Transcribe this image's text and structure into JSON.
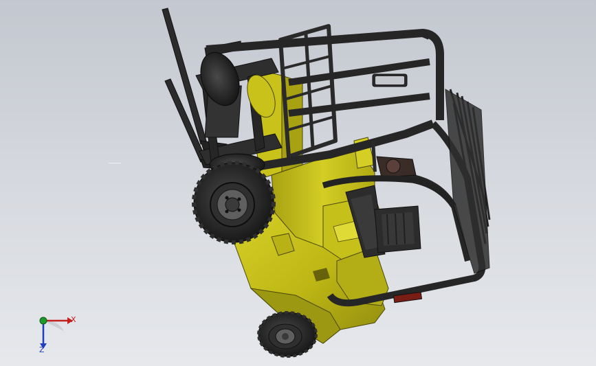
{
  "viewport": {
    "background_top": "#c3c7cf",
    "background_bottom": "#e6e8ec",
    "model": {
      "name": "forklift",
      "body_color": "#c9c21a",
      "body_shadow": "#8f8a10",
      "frame_color": "#2b2b2b",
      "tire_color": "#1e1e1e",
      "rim_color": "#6b6b6b"
    }
  },
  "triad": {
    "x_label": "X",
    "z_label": "Z",
    "x_color": "#c21f1f",
    "y_color": "#1e9a2a",
    "z_color": "#1e3fbf"
  }
}
